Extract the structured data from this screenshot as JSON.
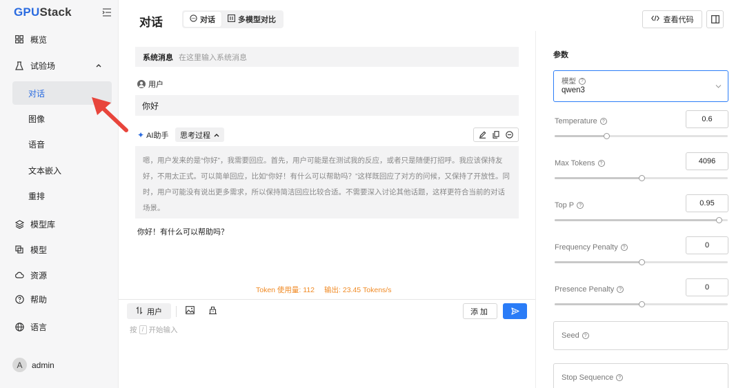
{
  "sidebar": {
    "logo_main": "GPU",
    "logo_suffix": "Stack",
    "items": [
      {
        "label": "概览"
      },
      {
        "label": "试验场"
      },
      {
        "label": "对话"
      },
      {
        "label": "图像"
      },
      {
        "label": "语音"
      },
      {
        "label": "文本嵌入"
      },
      {
        "label": "重排"
      },
      {
        "label": "模型库"
      },
      {
        "label": "模型"
      },
      {
        "label": "资源"
      },
      {
        "label": "帮助"
      },
      {
        "label": "语言"
      }
    ],
    "user": {
      "initial": "A",
      "name": "admin"
    }
  },
  "header": {
    "title": "对话",
    "tabs": [
      {
        "label": "对话"
      },
      {
        "label": "多模型对比"
      }
    ],
    "view_code_label": "查看代码"
  },
  "chat": {
    "system_label": "系统消息",
    "system_placeholder": "在这里输入系统消息",
    "user_role": "用户",
    "user_message": "你好",
    "ai_role": "AI助手",
    "thinking_label": "思考过程",
    "thinking_text": "嗯，用户发来的是“你好”，我需要回应。首先，用户可能是在测试我的反应，或者只是随便打招呼。我应该保持友好，不用太正式。可以简单回应，比如“你好！有什么可以帮助吗？”这样既回应了对方的问候，又保持了开放性。同时，用户可能没有说出更多需求，所以保持简洁回应比较合适。不需要深入讨论其他话题，这样更符合当前的对话场景。",
    "reply": "你好！有什么可以帮助吗？",
    "token_usage": "Token 使用量: 112",
    "output_speed": "输出: 23.45 Tokens/s"
  },
  "composer": {
    "role_label": "用户",
    "add_label": "添加",
    "hint_prefix": "按",
    "hint_key": "/",
    "hint_suffix": "开始输入"
  },
  "params": {
    "title": "参数",
    "model_label": "模型",
    "model_value": "qwen3",
    "sliders": [
      {
        "label": "Temperature",
        "value": "0.6",
        "fraction": 0.3
      },
      {
        "label": "Max Tokens",
        "value": "4096",
        "fraction": 0.5
      },
      {
        "label": "Top P",
        "value": "0.95",
        "fraction": 0.95
      },
      {
        "label": "Frequency Penalty",
        "value": "0",
        "fraction": 0.5
      },
      {
        "label": "Presence Penalty",
        "value": "0",
        "fraction": 0.5
      }
    ],
    "seed_label": "Seed",
    "stop_label": "Stop Sequence"
  },
  "colors": {
    "accent": "#2a7cf7",
    "stats": "#f08a24",
    "arrow": "#e8453c"
  }
}
